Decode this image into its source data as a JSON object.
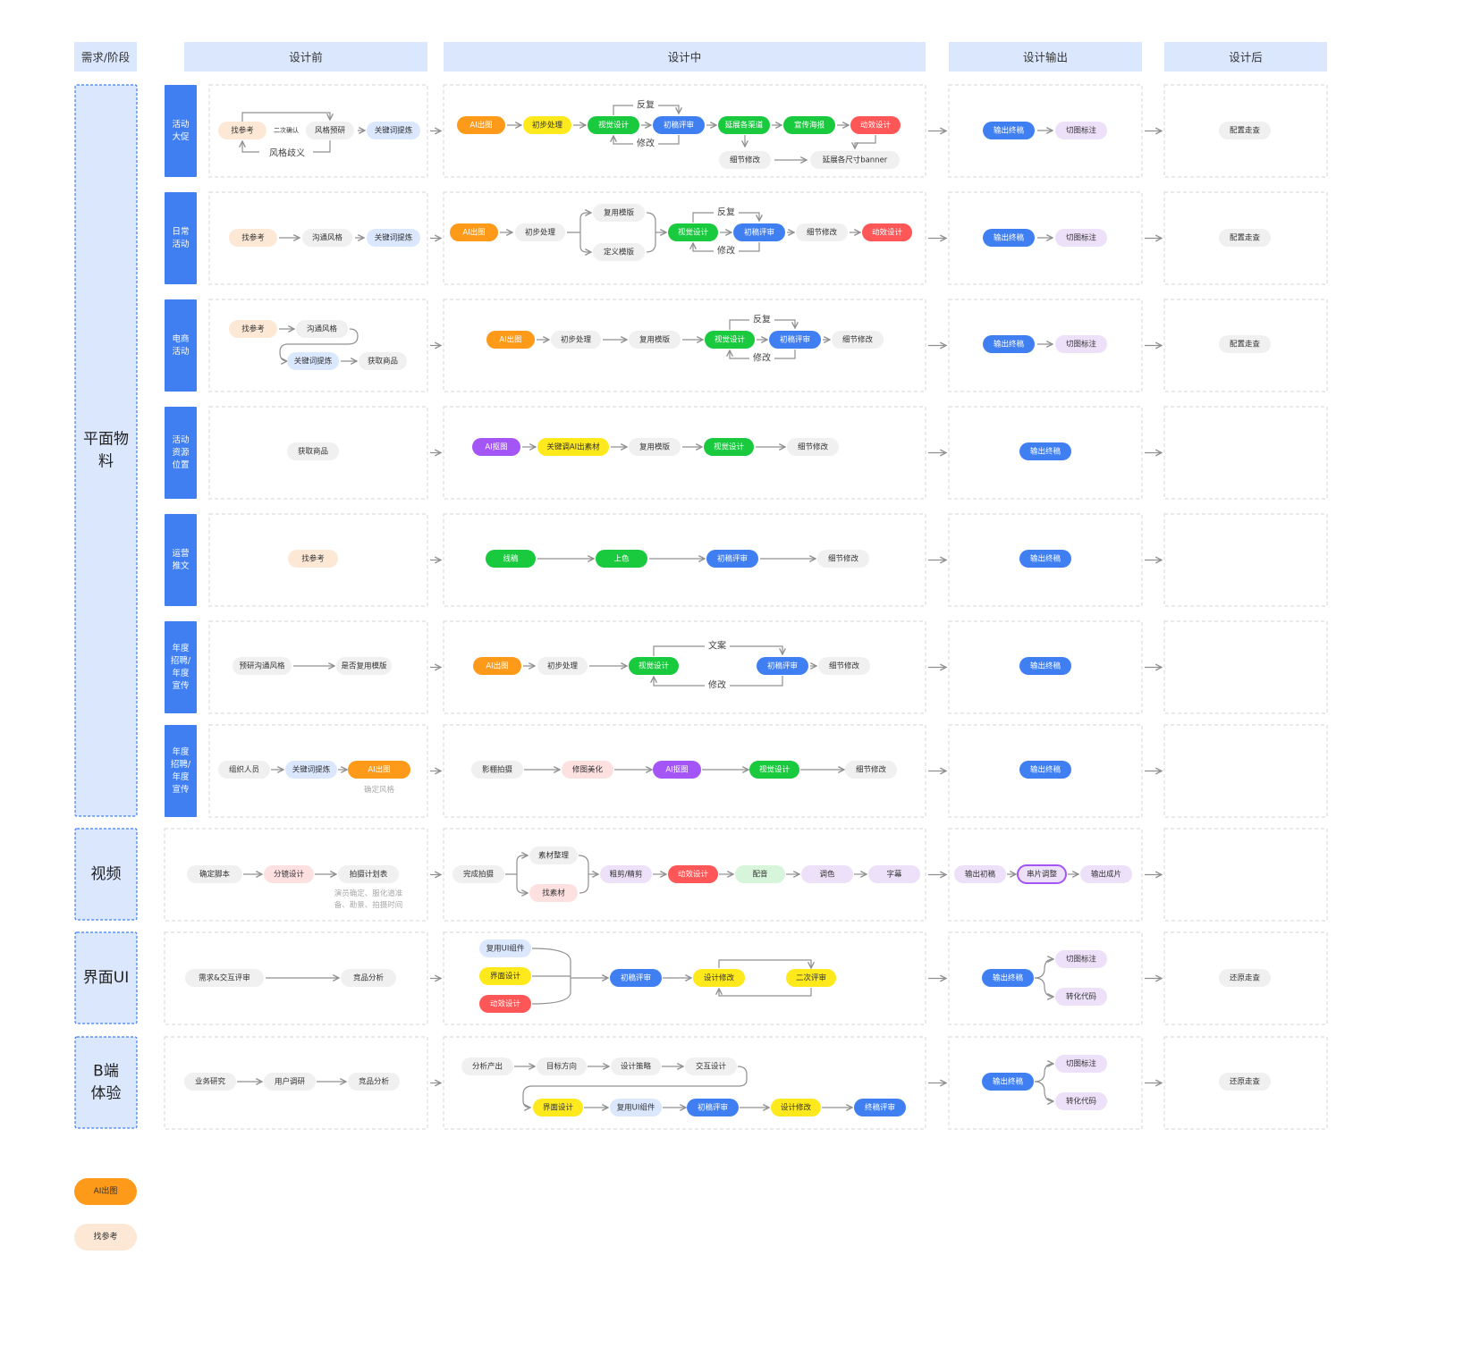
{
  "colors": {
    "orange": "#fe9a1a",
    "peach": "#fde8d6",
    "yellow": "#fde91c",
    "green": "#19c93e",
    "lightgreen": "#d6f5da",
    "blue": "#3f7ff2",
    "red": "#ff5757",
    "gray": "#f0f0f0",
    "lightblue": "#dbe7fd",
    "lavender": "#ede1fa",
    "purple": "#a355f5",
    "pink": "#fde1e1",
    "header": "#dbe7fd",
    "sidebar": "#3f7ff2",
    "cell_border": "#d5d5d5",
    "arrow": "#909090"
  },
  "headers": {
    "stage": "需求/阶段",
    "pre": "设计前",
    "mid": "设计中",
    "out": "设计输出",
    "post": "设计后"
  },
  "categories": {
    "graphic": [
      "平面物",
      "料"
    ],
    "video": "视频",
    "ui": "界面UI",
    "b": [
      "B端",
      "体验"
    ]
  },
  "subcategories": [
    [
      "活动",
      "大促"
    ],
    [
      "日常",
      "活动"
    ],
    [
      "电商",
      "活动"
    ],
    [
      "活动",
      "资源",
      "位置"
    ],
    [
      "运营",
      "推文"
    ],
    [
      "年度",
      "招聘/",
      "年度",
      "宣传"
    ],
    [
      "年度",
      "招聘/",
      "年度",
      "宣传"
    ]
  ],
  "legend": [
    {
      "label": "AI出图",
      "color": "orange"
    },
    {
      "label": "找参考",
      "color": "peach"
    }
  ],
  "pill_text": {
    "ai_out": "AI出图",
    "ai_cut": "AI抠图",
    "find_ref": "找参考",
    "style_research": "风格预研",
    "keyword": "关键词提炼",
    "prelim": "初步处理",
    "visual": "视觉设计",
    "first_review": "初稿评审",
    "extend_channels": "延展各渠道",
    "poster": "宣传海报",
    "motion": "动效设计",
    "detail": "细节修改",
    "extend_banner": "延展各尺寸banner",
    "final": "输出终稿",
    "slice": "切图标注",
    "config_check": "配置走查",
    "communicate": "沟通风格",
    "reuse_template": "复用模版",
    "define_template": "定义模版",
    "get_goods": "获取商品",
    "keyword_ai": "关键调AI出素材",
    "lineart": "线稿",
    "coloring": "上色",
    "research_comm": "预研沟通风格",
    "reuse_or_not": "是否复用模版",
    "organize": "组织人员",
    "shoot": "影棚拍摄",
    "retouch": "修图美化",
    "confirm_script": "确定脚本",
    "storyboard": "分镜设计",
    "shoot_plan": "拍摄计划表",
    "done_shoot": "完成拍摄",
    "material_sort": "素材整理",
    "find_material": "找素材",
    "rough_cut": "粗剪/精剪",
    "dubbing": "配音",
    "grading": "调色",
    "subtitle": "字幕",
    "first_out": "输出初稿",
    "clip_adjust": "串片调整",
    "final_film": "输出成片",
    "req_review": "需求&交互评审",
    "competitor": "竞品分析",
    "reuse_ui": "复用UI组件",
    "ui_design": "界面设计",
    "design_fix": "设计修改",
    "second_review": "二次评审",
    "restore_check": "还原走查",
    "to_code": "转化代码",
    "biz_research": "业务研究",
    "user_research": "用户调研",
    "analysis_out": "分析产出",
    "goal": "目标方向",
    "strategy": "设计策略",
    "interaction": "交互设计",
    "final_review": "终稿评审"
  },
  "small_text": {
    "repeat": "反复",
    "modify": "修改",
    "style_disagree": "风格歧义",
    "second_confirm": "二次确认",
    "copy": "文案",
    "style_confirm": "确定风格",
    "note_line1": "演员确定、服化道准",
    "note_line2": "备、勘景、拍摄时间"
  }
}
